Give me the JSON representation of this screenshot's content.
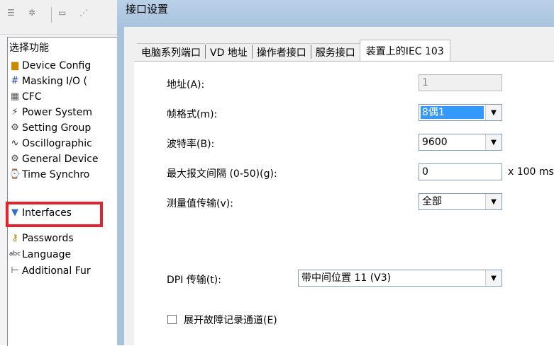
{
  "left_pane": {
    "toolbar": {
      "icons": [
        "expand-all-icon",
        "collapse-all-icon",
        "list-view-icon",
        "tree-view-icon"
      ]
    },
    "tree_header": "选择功能",
    "items": [
      {
        "label": "Device Config",
        "icon": "folder-icon"
      },
      {
        "label": "Masking I/O (",
        "icon": "masking-grid-icon"
      },
      {
        "label": "CFC",
        "icon": "cfc-icon"
      },
      {
        "label": "Power System",
        "icon": "power-system-icon"
      },
      {
        "label": "Setting Group",
        "icon": "setting-group-icon"
      },
      {
        "label": "Oscillographic",
        "icon": "oscillograph-icon"
      },
      {
        "label": "General Device",
        "icon": "general-device-icon"
      },
      {
        "label": "Time Synchro",
        "icon": "time-sync-icon"
      },
      {
        "label": "Interfaces",
        "icon": "interfaces-icon"
      },
      {
        "label": "Passwords",
        "icon": "key-icon"
      },
      {
        "label": "Language",
        "icon": "language-icon"
      },
      {
        "label": "Additional Fur",
        "icon": "additional-functions-icon"
      }
    ],
    "highlighted_item": "Interfaces",
    "highlight_color": "#e2222c"
  },
  "window": {
    "title": "接口设置",
    "tabs": [
      {
        "label": "电脑系列端口",
        "active": false
      },
      {
        "label": "VD 地址",
        "active": false
      },
      {
        "label": "操作者接口",
        "active": false
      },
      {
        "label": "服务接口",
        "active": false
      },
      {
        "label": "装置上的IEC 103",
        "active": true
      }
    ],
    "form": {
      "address": {
        "label": "地址(A):",
        "value": "1",
        "disabled": true
      },
      "frame_format": {
        "label": "帧格式(m):",
        "value": "8偶1"
      },
      "baud_rate": {
        "label": "波特率(B):",
        "value": "9600"
      },
      "max_message_gap": {
        "label": "最大报文间隔 (0-50)(g):",
        "value": "0",
        "unit": "x 100 ms"
      },
      "measured_value_transfer": {
        "label": "测量值传输(v):",
        "value": "全部"
      },
      "dpi_transfer": {
        "label": "DPI 传输(t):",
        "value": "带中间位置 11 (V3)"
      },
      "fault_record_channel": {
        "label": "展开故障记录通道(E)",
        "checked": false
      }
    }
  },
  "colors": {
    "title_bar": "#a9c3de",
    "selection": "#3399ff",
    "highlight": "#e2222c"
  }
}
